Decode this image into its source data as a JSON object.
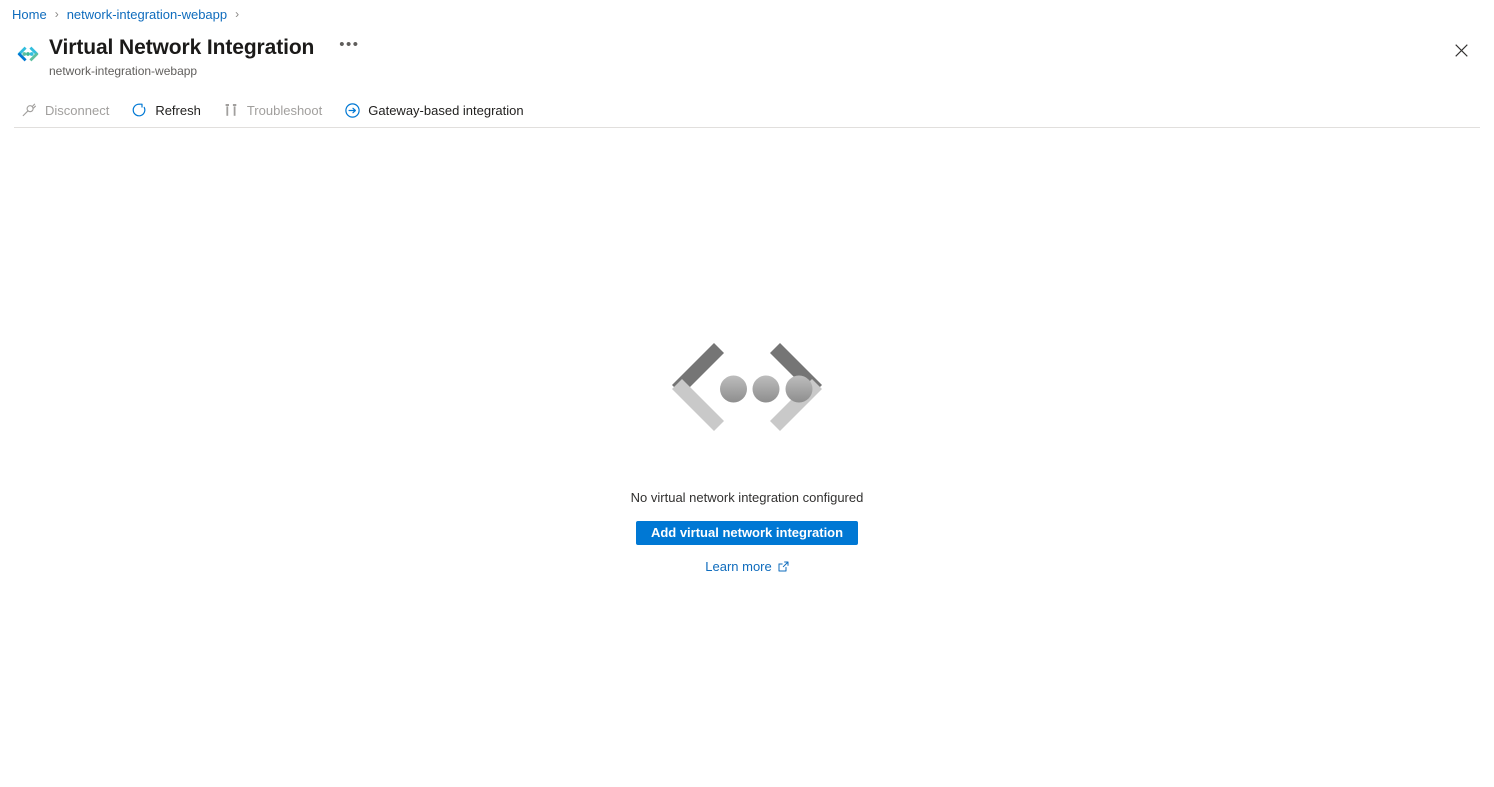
{
  "breadcrumb": {
    "items": [
      {
        "label": "Home"
      },
      {
        "label": "network-integration-webapp"
      }
    ],
    "separator": "›"
  },
  "header": {
    "icon": "virtual-network-integration-icon",
    "title": "Virtual Network Integration",
    "subtitle": "network-integration-webapp",
    "more_label": "•••",
    "close_label": "Close"
  },
  "toolbar": {
    "items": [
      {
        "label": "Disconnect",
        "icon": "disconnect-plug-icon",
        "enabled": false
      },
      {
        "label": "Refresh",
        "icon": "refresh-icon",
        "enabled": true
      },
      {
        "label": "Troubleshoot",
        "icon": "troubleshoot-tools-icon",
        "enabled": false
      },
      {
        "label": "Gateway-based integration",
        "icon": "arrow-right-circle-icon",
        "enabled": true
      }
    ]
  },
  "empty_state": {
    "illustration": "chevron-dots-illustration",
    "message": "No virtual network integration configured",
    "primary_button": "Add virtual network integration",
    "learn_more": "Learn more",
    "learn_more_icon": "external-link-icon"
  },
  "colors": {
    "accent": "#0078d4",
    "link": "#0f6cbd",
    "disabled_text": "#a19f9d",
    "divider": "#e1dfdd",
    "illustration_dark": "#757575",
    "illustration_light": "#c9c9c9"
  }
}
